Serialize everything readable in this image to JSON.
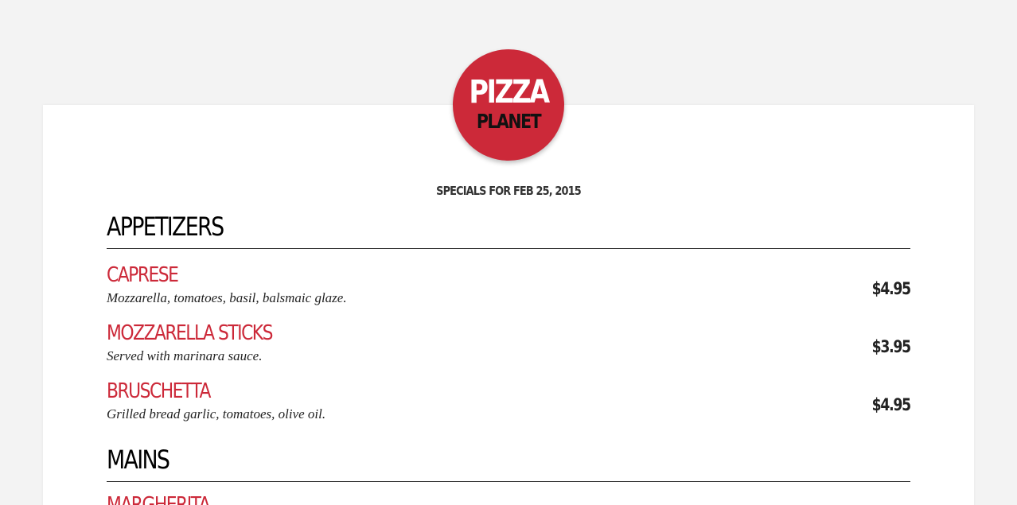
{
  "theme": {
    "accent": "#cc2939",
    "logo_bg": "#cc2939",
    "page_bg": "#f3f3f3",
    "card_bg": "#ffffff"
  },
  "logo": {
    "line1": "PIZZA",
    "line2": "PLANET"
  },
  "specials_date": "SPECIALS FOR FEB 25, 2015",
  "sections": [
    {
      "title": "APPETIZERS",
      "items": [
        {
          "name": "CAPRESE",
          "description": "Mozzarella, tomatoes, basil, balsmaic glaze.",
          "price": "$4.95"
        },
        {
          "name": "MOZZARELLA STICKS",
          "description": "Served with marinara sauce.",
          "price": "$3.95"
        },
        {
          "name": "BRUSCHETTA",
          "description": "Grilled bread garlic, tomatoes, olive oil.",
          "price": "$4.95"
        }
      ]
    },
    {
      "title": "MAINS",
      "items": [
        {
          "name": "MARGHERITA"
        }
      ]
    }
  ]
}
